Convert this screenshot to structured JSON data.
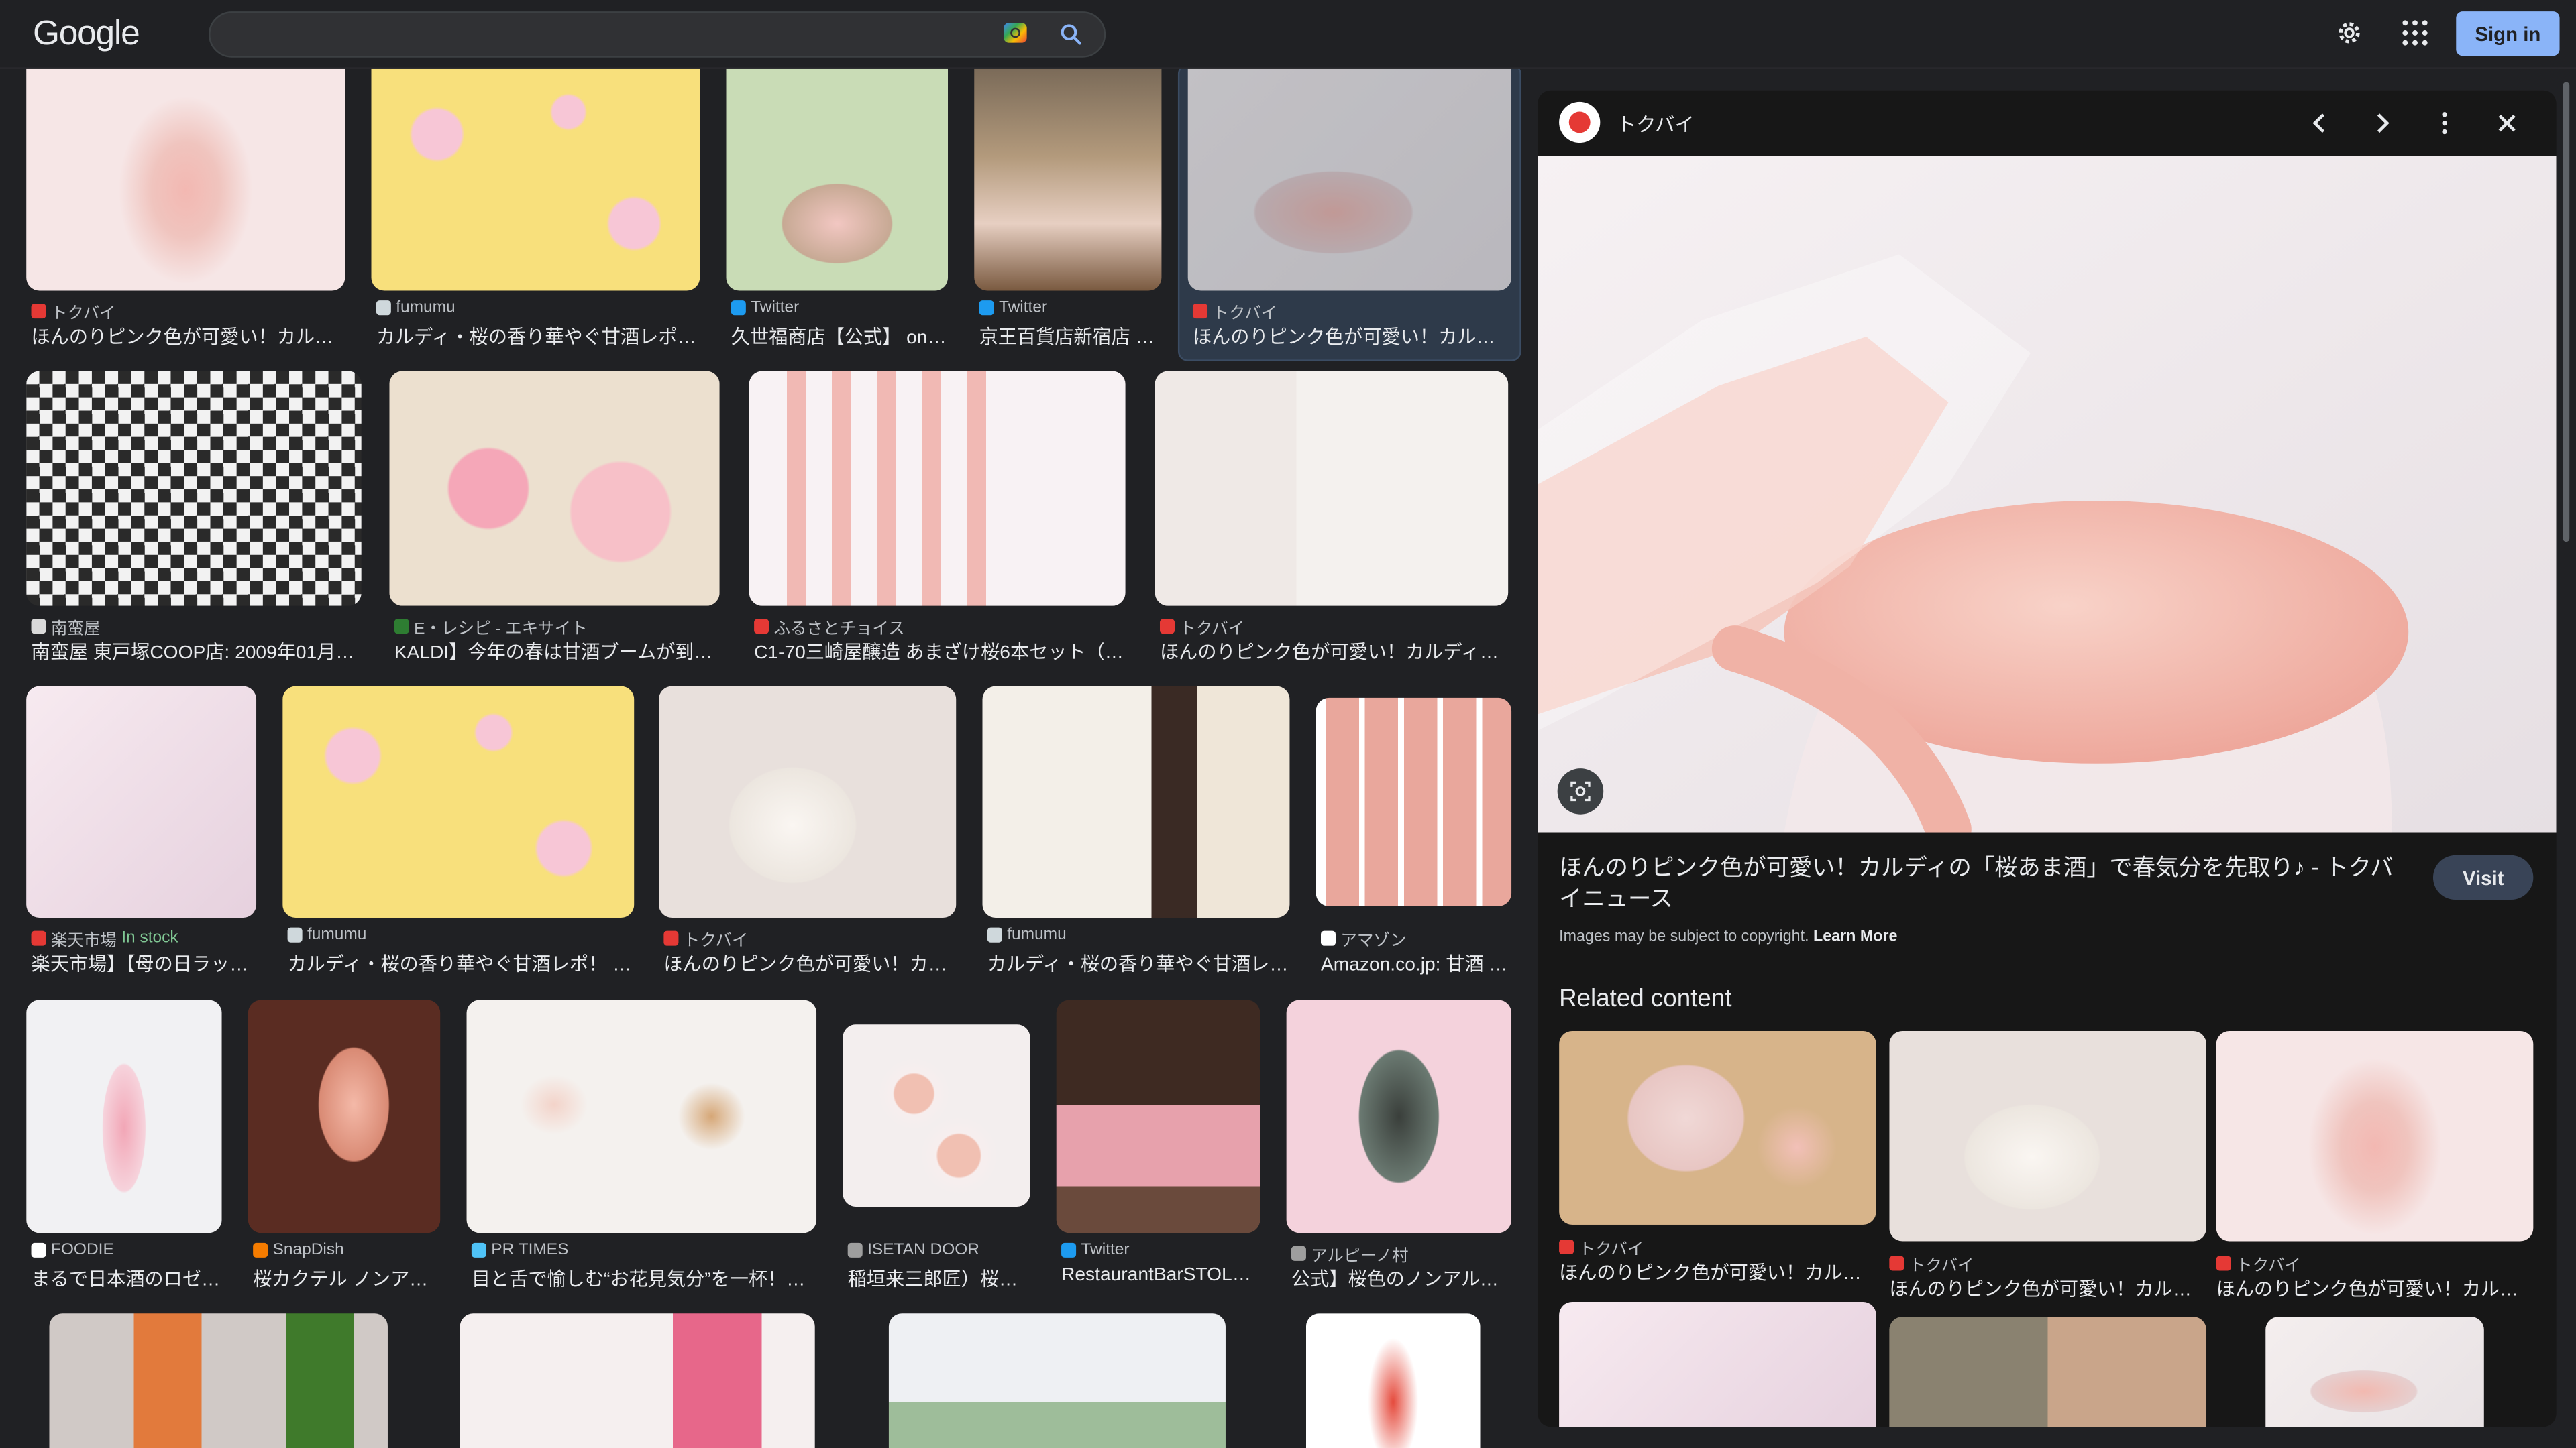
{
  "header": {
    "logo": "Google",
    "search_value": "",
    "signin_label": "Sign in"
  },
  "grid": [
    {
      "source": "トクバイ",
      "title": "ほんのりピンク色が可愛い！カルデ…",
      "fav": "#e53935",
      "img": "bg-pinkbottle"
    },
    {
      "source": "fumumu",
      "title": "カルディ・桜の香り華やぐ甘酒レポ…",
      "fav": "#cfd8dc",
      "img": "bg-yellowsakura"
    },
    {
      "source": "Twitter",
      "title": "久世福商店【公式】 on …",
      "fav": "#1d9bf0",
      "img": "bg-greenbowl"
    },
    {
      "source": "Twitter",
      "title": "京王百貨店新宿店 …",
      "fav": "#1d9bf0",
      "img": "bg-shelf"
    },
    {
      "source": "トクバイ",
      "title": "ほんのりピンク色が可愛い！カルデ…",
      "fav": "#e53935",
      "img": "bg-pour"
    },
    {
      "source": "南蛮屋",
      "title": "南蛮屋 東戸塚COOP店: 2009年01月 …",
      "fav": "#d9d9d9",
      "img": "bg-checker"
    },
    {
      "source": "E・レシピ - エキサイト",
      "title": "KALDI】今年の春は甘酒ブームが到来…",
      "fav": "#2e7d32",
      "img": "bg-sakurapack"
    },
    {
      "source": "ふるさとチョイス",
      "title": "C1-70三崎屋醸造 あまざけ桜6本セット（7…",
      "fav": "#e53935",
      "img": "bg-sixbottles"
    },
    {
      "source": "トクバイ",
      "title": "ほんのりピンク色が可愛い！カルディの…",
      "fav": "#e53935",
      "img": "bg-label"
    },
    {
      "source": "楽天市場",
      "stock": "In stock",
      "title": "楽天市場】【母の日ラッ…",
      "fav": "#e53935",
      "img": "bg-lilac"
    },
    {
      "source": "fumumu",
      "title": "カルディ・桜の香り華やぐ甘酒レポ！ …",
      "fav": "#cfd8dc",
      "img": "bg-yellowsakura"
    },
    {
      "source": "トクバイ",
      "title": "ほんのりピンク色が可愛い！カ…",
      "fav": "#e53935",
      "img": "bg-cup"
    },
    {
      "source": "fumumu",
      "title": "カルディ・桜の香り華やぐ甘酒レ…",
      "fav": "#cfd8dc",
      "img": "bg-nutri"
    },
    {
      "source": "アマゾン",
      "title": "Amazon.co.jp: 甘酒 …",
      "fav": "#ffffff",
      "img": "bg-fivebottles"
    },
    {
      "source": "FOODIE",
      "title": "まるで日本酒のロゼ!…",
      "fav": "#ffffff",
      "img": "bg-slimbottle"
    },
    {
      "source": "SnapDish",
      "title": "桜カクテル ノンアル…",
      "fav": "#f57c00",
      "img": "bg-coupe"
    },
    {
      "source": "PR TIMES",
      "title": "目と舌で愉しむ“お花見気分”を一杯！世…",
      "fav": "#4fc3f7",
      "img": "bg-cocktail"
    },
    {
      "source": "ISETAN DOOR",
      "title": "稲垣来三郎匠）桜あ…",
      "fav": "#9e9e9e",
      "img": "bg-teacups"
    },
    {
      "source": "Twitter",
      "title": "RestaurantBarSTOLA…",
      "fav": "#1d9bf0",
      "img": "bg-monin"
    },
    {
      "source": "アルピーノ村",
      "title": "公式】桜色のノンアルコ…",
      "fav": "#9e9e9e",
      "img": "bg-sakurapost"
    },
    {
      "img": "bg-row5a"
    },
    {
      "img": "bg-row5b"
    },
    {
      "img": "bg-row5c"
    },
    {
      "img": "bg-row5d"
    }
  ],
  "panel": {
    "site": "トクバイ",
    "title": "ほんのりピンク色が可愛い！カルディの「桜あま酒」で春気分を先取り♪ - トクバイニュース",
    "visit_label": "Visit",
    "copyright": "Images may be subject to copyright.",
    "learn_more": "Learn More",
    "related_heading": "Related content",
    "related": [
      {
        "source": "トクバイ",
        "title": "ほんのりピンク色が可愛い！カル…",
        "img": "bg-relimg1"
      },
      {
        "source": "トクバイ",
        "title": "ほんのりピンク色が可愛い！カル…",
        "img": "bg-cup"
      },
      {
        "source": "トクバイ",
        "title": "ほんのりピンク色が可愛い！カル…",
        "img": "bg-pinkbottle"
      },
      {
        "img": "bg-lilac"
      },
      {
        "img": "bg-relimg5"
      },
      {
        "img": "bg-pour"
      }
    ]
  }
}
